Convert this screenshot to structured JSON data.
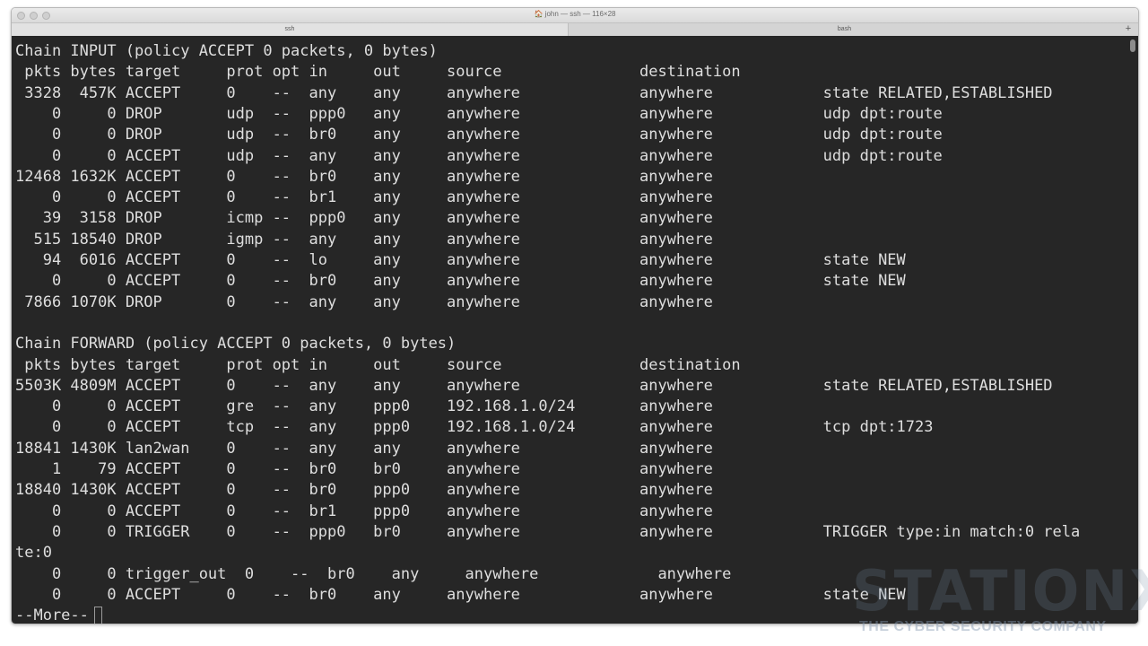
{
  "window": {
    "title": "🏠 john — ssh — 116×28",
    "tabs": [
      {
        "label": "ssh"
      },
      {
        "label": "bash"
      }
    ],
    "new_tab_label": "+"
  },
  "terminal": {
    "lines": [
      "Chain INPUT (policy ACCEPT 0 packets, 0 bytes)",
      " pkts bytes target     prot opt in     out     source               destination",
      " 3328  457K ACCEPT     0    --  any    any     anywhere             anywhere            state RELATED,ESTABLISHED",
      "    0     0 DROP       udp  --  ppp0   any     anywhere             anywhere            udp dpt:route",
      "    0     0 DROP       udp  --  br0    any     anywhere             anywhere            udp dpt:route",
      "    0     0 ACCEPT     udp  --  any    any     anywhere             anywhere            udp dpt:route",
      "12468 1632K ACCEPT     0    --  br0    any     anywhere             anywhere",
      "    0     0 ACCEPT     0    --  br1    any     anywhere             anywhere",
      "   39  3158 DROP       icmp --  ppp0   any     anywhere             anywhere",
      "  515 18540 DROP       igmp --  any    any     anywhere             anywhere",
      "   94  6016 ACCEPT     0    --  lo     any     anywhere             anywhere            state NEW",
      "    0     0 ACCEPT     0    --  br0    any     anywhere             anywhere            state NEW",
      " 7866 1070K DROP       0    --  any    any     anywhere             anywhere",
      "",
      "Chain FORWARD (policy ACCEPT 0 packets, 0 bytes)",
      " pkts bytes target     prot opt in     out     source               destination",
      "5503K 4809M ACCEPT     0    --  any    any     anywhere             anywhere            state RELATED,ESTABLISHED",
      "    0     0 ACCEPT     gre  --  any    ppp0    192.168.1.0/24       anywhere",
      "    0     0 ACCEPT     tcp  --  any    ppp0    192.168.1.0/24       anywhere            tcp dpt:1723",
      "18841 1430K lan2wan    0    --  any    any     anywhere             anywhere",
      "    1    79 ACCEPT     0    --  br0    br0     anywhere             anywhere",
      "18840 1430K ACCEPT     0    --  br0    ppp0    anywhere             anywhere",
      "    0     0 ACCEPT     0    --  br1    ppp0    anywhere             anywhere",
      "    0     0 TRIGGER    0    --  ppp0   br0     anywhere             anywhere            TRIGGER type:in match:0 rela",
      "te:0",
      "    0     0 trigger_out  0    --  br0    any     anywhere             anywhere",
      "    0     0 ACCEPT     0    --  br0    any     anywhere             anywhere            state NEW"
    ],
    "prompt": "--More--"
  },
  "watermark": {
    "logo_text": "STATIONX",
    "tagline": "THE CYBER SECURITY COMPANY"
  }
}
